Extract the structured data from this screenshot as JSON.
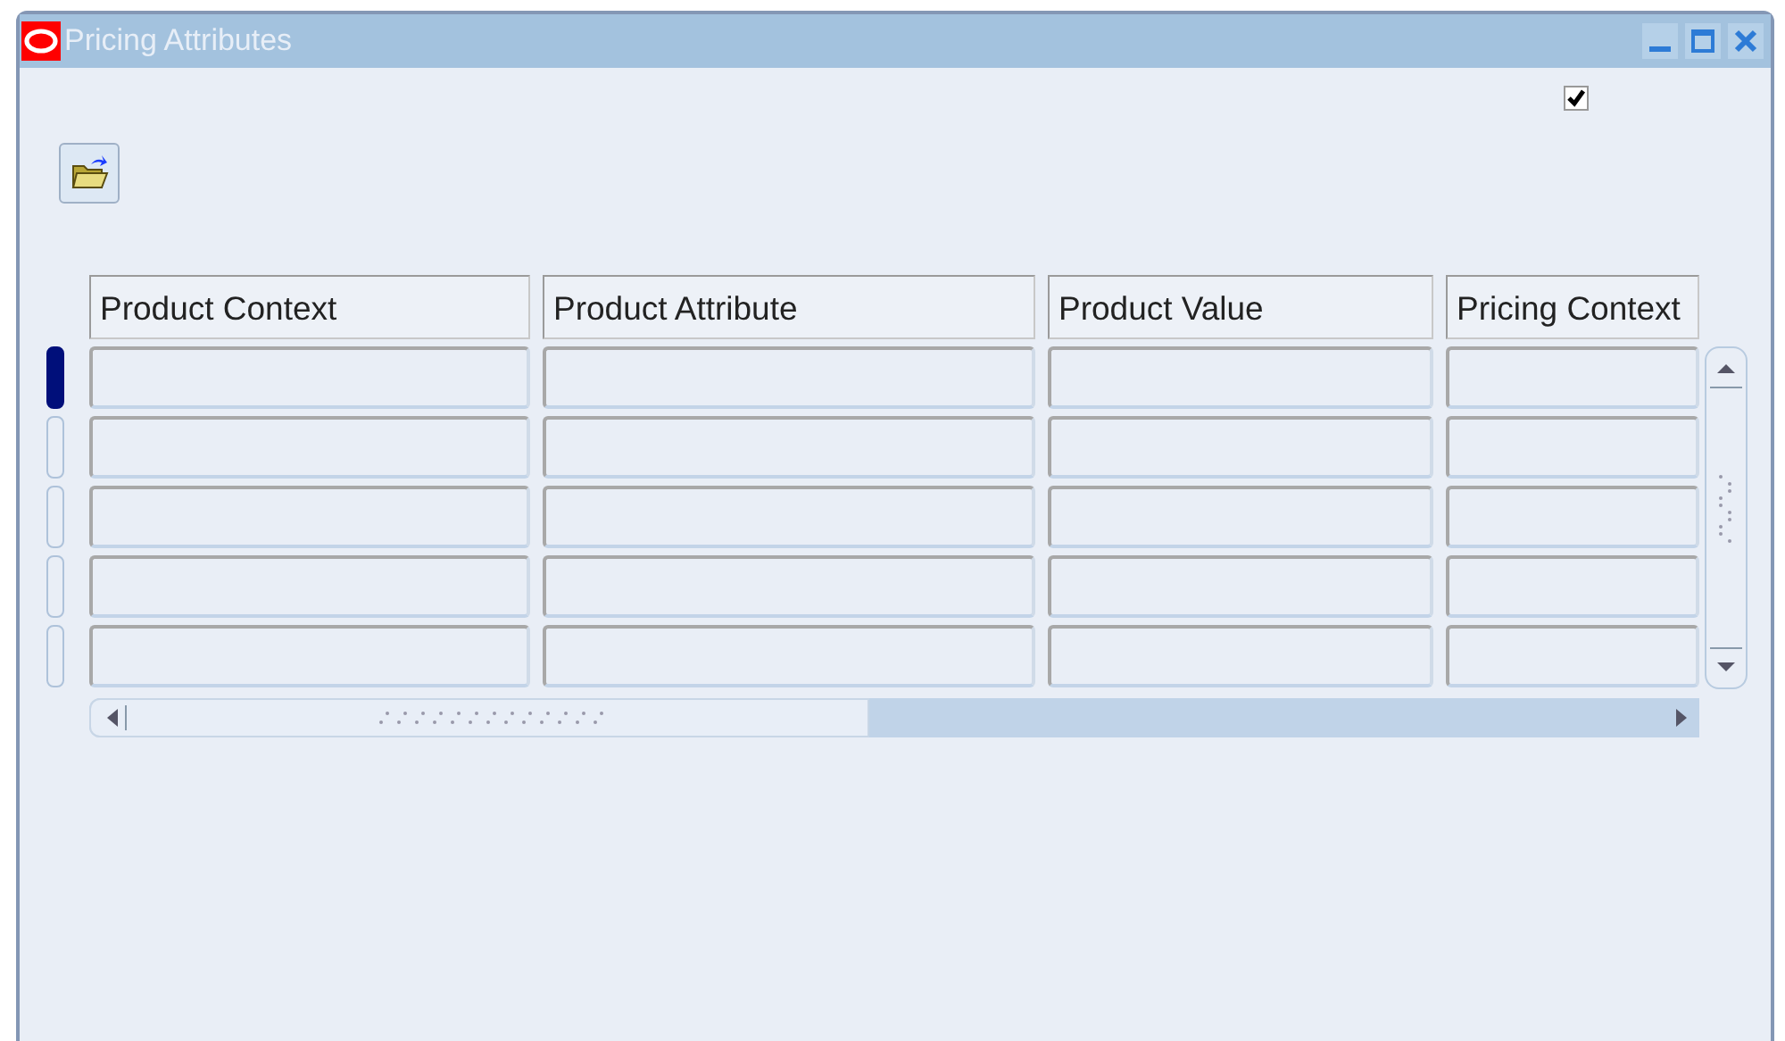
{
  "window": {
    "title": "Pricing Attributes"
  },
  "checkbox": {
    "checked": true
  },
  "table": {
    "columns": [
      "Product Context",
      "Product Attribute",
      "Product Value",
      "Pricing Context"
    ],
    "rows": [
      {
        "selected": true
      },
      {
        "selected": false
      },
      {
        "selected": false
      },
      {
        "selected": false
      },
      {
        "selected": false
      }
    ]
  }
}
